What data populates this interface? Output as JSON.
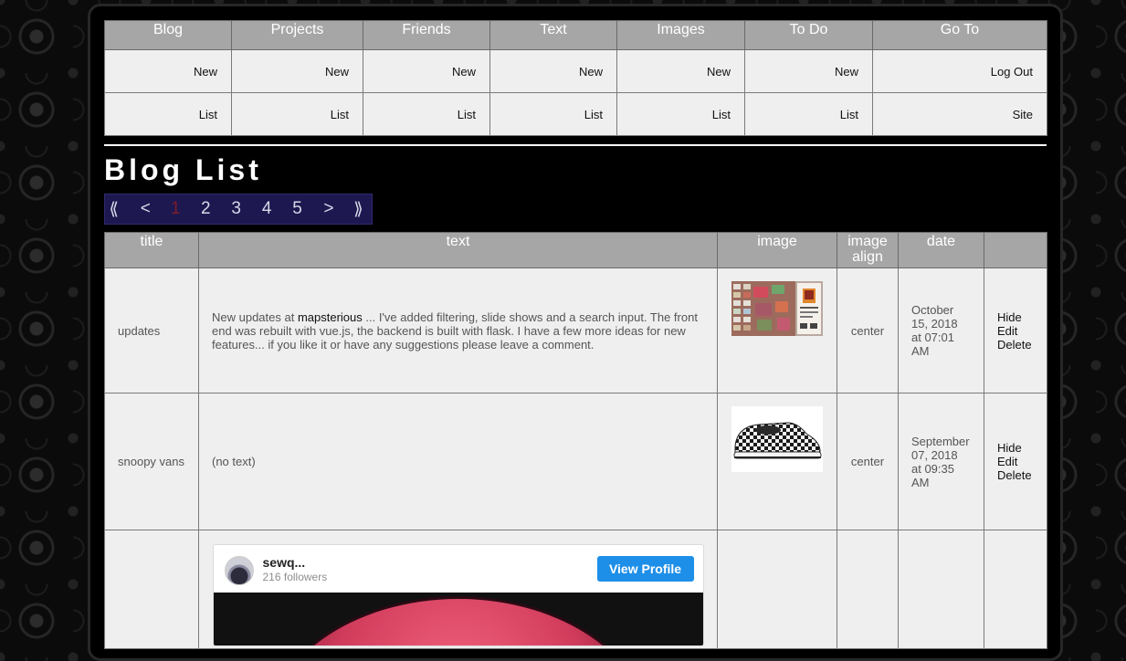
{
  "nav": {
    "headers": [
      "Blog",
      "Projects",
      "Friends",
      "Text",
      "Images",
      "To Do",
      "Go To"
    ],
    "row1": [
      "New",
      "New",
      "New",
      "New",
      "New",
      "New",
      "Log Out"
    ],
    "row2": [
      "List",
      "List",
      "List",
      "List",
      "List",
      "List",
      "Site"
    ]
  },
  "page_title": "Blog List",
  "pager": {
    "first": "⟪",
    "prev": "<",
    "pages": [
      "1",
      "2",
      "3",
      "4",
      "5"
    ],
    "current": "1",
    "next": ">",
    "last": "⟫"
  },
  "table": {
    "headers": {
      "title": "title",
      "text": "text",
      "image": "image",
      "image_align_1": "image",
      "image_align_2": "align",
      "date": "date",
      "actions": ""
    },
    "rows": [
      {
        "title": "updates",
        "text_before": "New updates at ",
        "text_link": "mapsterious",
        "text_after": " ... I've added filtering, slide shows and a search input. The front end was rebuilt with vue.js, the backend is built with flask. I have a few more ideas for new features... if you like it or have any suggestions please leave a comment.",
        "image_icon": "map-collage-thumbnail",
        "align": "center",
        "date": "October 15, 2018 at 07:01 AM",
        "actions": [
          "Hide",
          "Edit",
          "Delete"
        ]
      },
      {
        "title": "snoopy vans",
        "text": "(no text)",
        "image_icon": "checkered-sneaker-thumbnail",
        "align": "center",
        "date": "September 07, 2018 at 09:35 AM",
        "actions": [
          "Hide",
          "Edit",
          "Delete"
        ]
      },
      {
        "embed": {
          "username": "sewq...",
          "followers": "216 followers",
          "button": "View Profile",
          "avatar_icon": "profile-avatar"
        }
      }
    ]
  },
  "colors": {
    "header_gray": "#a6a6a6",
    "cell_bg": "#efefef",
    "pager_bg": "#1e1850",
    "instagram_blue": "#1e8fe8"
  }
}
